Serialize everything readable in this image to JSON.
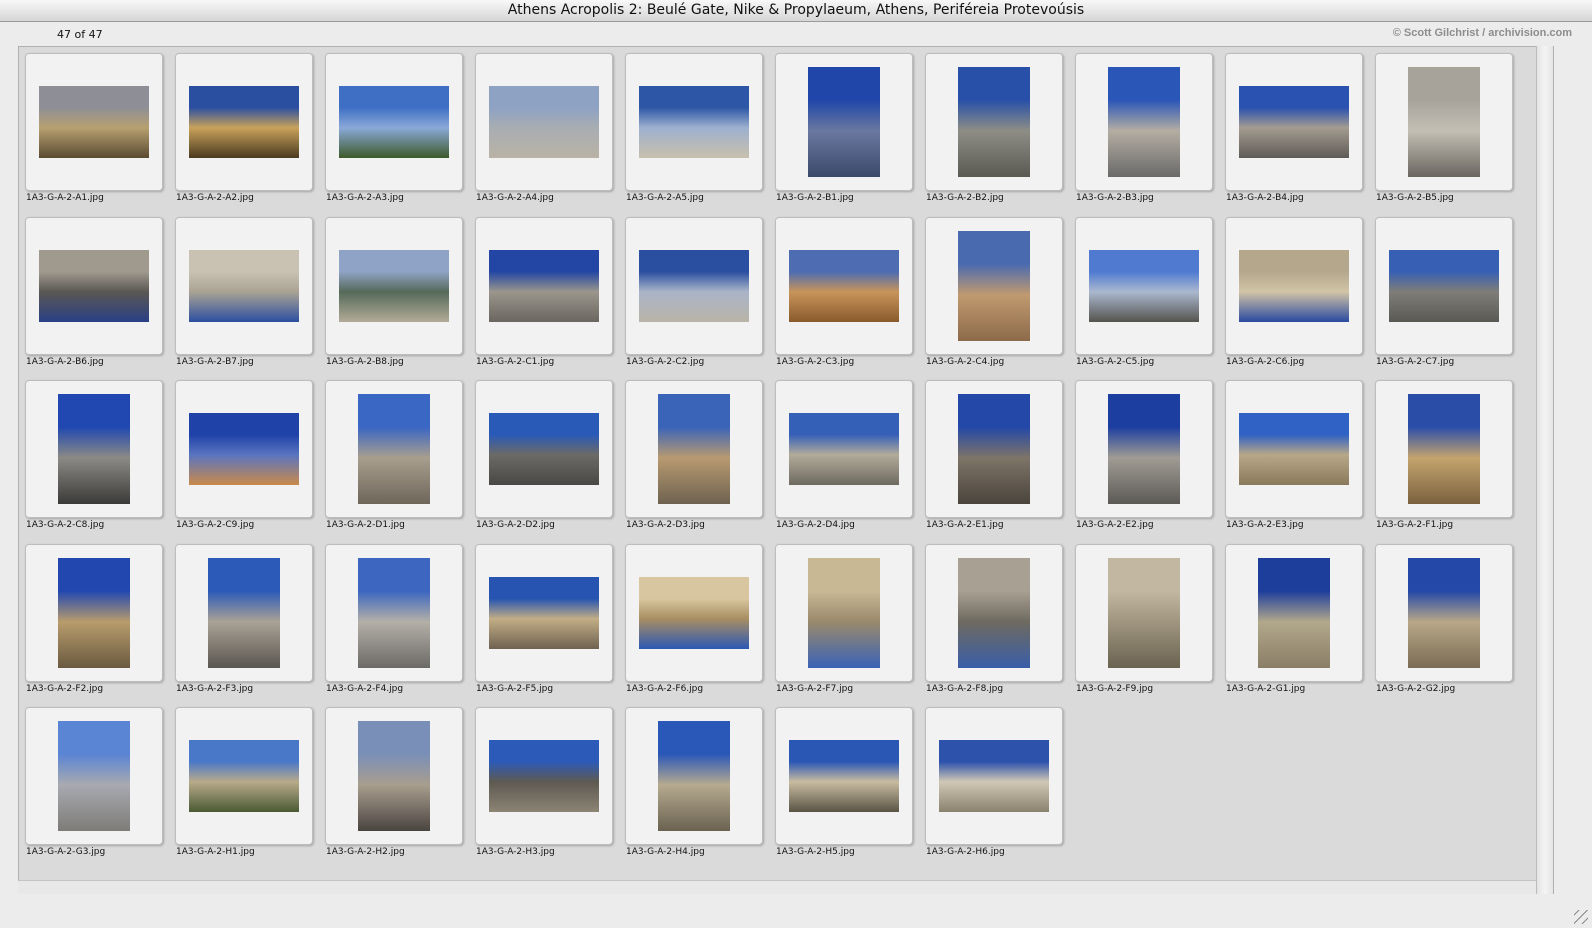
{
  "window": {
    "title": "Athens Acropolis 2: Beulé Gate, Nike & Propylaeum, Athens, Periféreia Protevoúsis"
  },
  "header": {
    "count": "47 of 47",
    "credit": "© Scott Gilchrist / archivision.com"
  },
  "thumbnails": [
    {
      "file": "1A3-G-A-2-A1.jpg",
      "orientation": "landscape",
      "tones": [
        "#8e8f96",
        "#b7a070",
        "#5a4a32"
      ]
    },
    {
      "file": "1A3-G-A-2-A2.jpg",
      "orientation": "landscape",
      "tones": [
        "#2b4fa0",
        "#c9a25a",
        "#4a3a20"
      ]
    },
    {
      "file": "1A3-G-A-2-A3.jpg",
      "orientation": "landscape",
      "tones": [
        "#3f6fc4",
        "#8aa9d8",
        "#3d5a2a"
      ]
    },
    {
      "file": "1A3-G-A-2-A4.jpg",
      "orientation": "landscape",
      "tones": [
        "#8ea2c4",
        "#a8adb2",
        "#b9b3a6"
      ]
    },
    {
      "file": "1A3-G-A-2-A5.jpg",
      "orientation": "landscape",
      "tones": [
        "#2d57a6",
        "#9db0cf",
        "#c8c0ad"
      ]
    },
    {
      "file": "1A3-G-A-2-B1.jpg",
      "orientation": "portrait",
      "tones": [
        "#1f46a8",
        "#6a78a0",
        "#3a4a6a"
      ]
    },
    {
      "file": "1A3-G-A-2-B2.jpg",
      "orientation": "portrait",
      "tones": [
        "#2850a8",
        "#8e8e86",
        "#5b5a52"
      ]
    },
    {
      "file": "1A3-G-A-2-B3.jpg",
      "orientation": "portrait",
      "tones": [
        "#2a56b8",
        "#b4aea2",
        "#6a6a6a"
      ]
    },
    {
      "file": "1A3-G-A-2-B4.jpg",
      "orientation": "landscape",
      "tones": [
        "#2a52b0",
        "#a49c90",
        "#5e5a56"
      ]
    },
    {
      "file": "1A3-G-A-2-B5.jpg",
      "orientation": "portrait",
      "tones": [
        "#a7a39b",
        "#c4bfb4",
        "#6a6660"
      ]
    },
    {
      "file": "1A3-G-A-2-B6.jpg",
      "orientation": "landscape",
      "tones": [
        "#a09a8e",
        "#5a5852",
        "#2a3f86"
      ]
    },
    {
      "file": "1A3-G-A-2-B7.jpg",
      "orientation": "landscape",
      "tones": [
        "#c9c2b3",
        "#aaa393",
        "#2c4fa0"
      ]
    },
    {
      "file": "1A3-G-A-2-B8.jpg",
      "orientation": "landscape",
      "tones": [
        "#8fa3c6",
        "#566a5a",
        "#b2ab98"
      ]
    },
    {
      "file": "1A3-G-A-2-C1.jpg",
      "orientation": "landscape",
      "tones": [
        "#2346a4",
        "#9a968c",
        "#6a6660"
      ]
    },
    {
      "file": "1A3-G-A-2-C2.jpg",
      "orientation": "landscape",
      "tones": [
        "#2a4ea0",
        "#aab4c8",
        "#b9b4a7"
      ]
    },
    {
      "file": "1A3-G-A-2-C3.jpg",
      "orientation": "landscape",
      "tones": [
        "#4d6cb2",
        "#c7955a",
        "#8a5a2c"
      ]
    },
    {
      "file": "1A3-G-A-2-C4.jpg",
      "orientation": "portrait",
      "tones": [
        "#4a6ab0",
        "#c09a70",
        "#8c6a4a"
      ]
    },
    {
      "file": "1A3-G-A-2-C5.jpg",
      "orientation": "landscape",
      "tones": [
        "#4f7ad0",
        "#aab8cf",
        "#55534e"
      ]
    },
    {
      "file": "1A3-G-A-2-C6.jpg",
      "orientation": "landscape",
      "tones": [
        "#b5a78c",
        "#d2c4a6",
        "#2a4aa0"
      ]
    },
    {
      "file": "1A3-G-A-2-C7.jpg",
      "orientation": "landscape",
      "tones": [
        "#3760b4",
        "#7f7d78",
        "#5b5954"
      ]
    },
    {
      "file": "1A3-G-A-2-C8.jpg",
      "orientation": "portrait",
      "tones": [
        "#2048b0",
        "#8c8a86",
        "#3a3a38"
      ]
    },
    {
      "file": "1A3-G-A-2-C9.jpg",
      "orientation": "landscape",
      "tones": [
        "#1f42a8",
        "#5a74c0",
        "#c98a4a"
      ]
    },
    {
      "file": "1A3-G-A-2-D1.jpg",
      "orientation": "portrait",
      "tones": [
        "#3a66c4",
        "#a89e8e",
        "#6e665a"
      ]
    },
    {
      "file": "1A3-G-A-2-D2.jpg",
      "orientation": "landscape",
      "tones": [
        "#2a5ab8",
        "#6c6a66",
        "#4a4844"
      ]
    },
    {
      "file": "1A3-G-A-2-D3.jpg",
      "orientation": "portrait",
      "tones": [
        "#3a64b8",
        "#b89a70",
        "#6e6250"
      ]
    },
    {
      "file": "1A3-G-A-2-D4.jpg",
      "orientation": "landscape",
      "tones": [
        "#3560b8",
        "#b2ab9a",
        "#6e6a60"
      ]
    },
    {
      "file": "1A3-G-A-2-E1.jpg",
      "orientation": "portrait",
      "tones": [
        "#2448a8",
        "#7e7468",
        "#4a443c"
      ]
    },
    {
      "file": "1A3-G-A-2-E2.jpg",
      "orientation": "portrait",
      "tones": [
        "#1c3ea0",
        "#a09c94",
        "#5c5a56"
      ]
    },
    {
      "file": "1A3-G-A-2-E3.jpg",
      "orientation": "landscape",
      "tones": [
        "#2f62c4",
        "#b8a788",
        "#8a7a5c"
      ]
    },
    {
      "file": "1A3-G-A-2-F1.jpg",
      "orientation": "portrait",
      "tones": [
        "#2a4ea8",
        "#c4a46e",
        "#7a6240"
      ]
    },
    {
      "file": "1A3-G-A-2-F2.jpg",
      "orientation": "portrait",
      "tones": [
        "#2248b0",
        "#b89c6c",
        "#6a5a40"
      ]
    },
    {
      "file": "1A3-G-A-2-F3.jpg",
      "orientation": "portrait",
      "tones": [
        "#2c5ab8",
        "#aaa296",
        "#5a5650"
      ]
    },
    {
      "file": "1A3-G-A-2-F4.jpg",
      "orientation": "portrait",
      "tones": [
        "#3c66c0",
        "#b4b0a8",
        "#6c6a66"
      ]
    },
    {
      "file": "1A3-G-A-2-F5.jpg",
      "orientation": "landscape",
      "tones": [
        "#2654b0",
        "#c2ad86",
        "#6e6250"
      ]
    },
    {
      "file": "1A3-G-A-2-F6.jpg",
      "orientation": "landscape",
      "tones": [
        "#d8c6a0",
        "#a88e62",
        "#2c58b4"
      ]
    },
    {
      "file": "1A3-G-A-2-F7.jpg",
      "orientation": "portrait",
      "tones": [
        "#c9b894",
        "#9a8a6c",
        "#3a62b6"
      ]
    },
    {
      "file": "1A3-G-A-2-F8.jpg",
      "orientation": "portrait",
      "tones": [
        "#a8a092",
        "#6e6a60",
        "#3a5ea8"
      ]
    },
    {
      "file": "1A3-G-A-2-F9.jpg",
      "orientation": "portrait",
      "tones": [
        "#c2b8a2",
        "#a09680",
        "#6a6250"
      ]
    },
    {
      "file": "1A3-G-A-2-G1.jpg",
      "orientation": "portrait",
      "tones": [
        "#1e3e9c",
        "#b2a88c",
        "#8a7e66"
      ]
    },
    {
      "file": "1A3-G-A-2-G2.jpg",
      "orientation": "portrait",
      "tones": [
        "#2448a8",
        "#b8a888",
        "#7a6c54"
      ]
    },
    {
      "file": "1A3-G-A-2-G3.jpg",
      "orientation": "portrait",
      "tones": [
        "#5a84d4",
        "#a8aab0",
        "#7e7c78"
      ]
    },
    {
      "file": "1A3-G-A-2-H1.jpg",
      "orientation": "landscape",
      "tones": [
        "#4a78c8",
        "#b8aa8a",
        "#4a5a34"
      ]
    },
    {
      "file": "1A3-G-A-2-H2.jpg",
      "orientation": "portrait",
      "tones": [
        "#7a8fb8",
        "#a89e8e",
        "#4a4440"
      ]
    },
    {
      "file": "1A3-G-A-2-H3.jpg",
      "orientation": "landscape",
      "tones": [
        "#2c5ab8",
        "#5e5a52",
        "#8c8474"
      ]
    },
    {
      "file": "1A3-G-A-2-H4.jpg",
      "orientation": "portrait",
      "tones": [
        "#2a58b8",
        "#b6aa90",
        "#6a6250"
      ]
    },
    {
      "file": "1A3-G-A-2-H5.jpg",
      "orientation": "landscape",
      "tones": [
        "#2a56b4",
        "#c8bca0",
        "#5a5446"
      ]
    },
    {
      "file": "1A3-G-A-2-H6.jpg",
      "orientation": "landscape",
      "tones": [
        "#2c52ac",
        "#d0c8b4",
        "#8a826e"
      ]
    }
  ]
}
